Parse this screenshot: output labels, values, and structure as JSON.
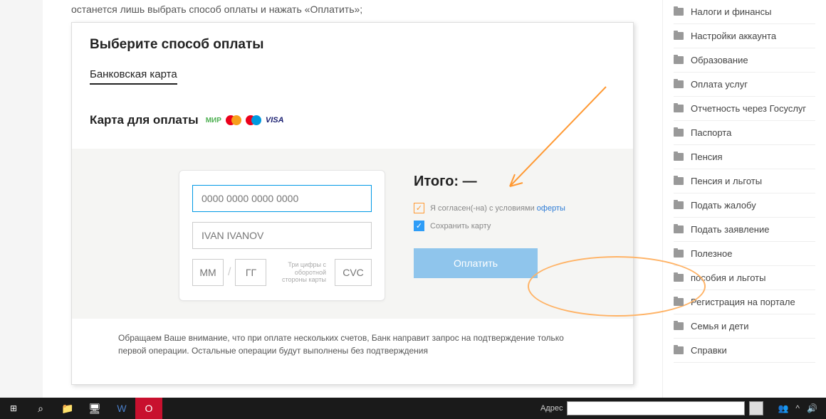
{
  "intro": "останется лишь выбрать способ оплаты и нажать «Оплатить»;",
  "panel": {
    "title": "Выберите способ оплаты",
    "tab": "Банковская карта",
    "card_label": "Карта для оплаты",
    "logos": {
      "mir": "МИР",
      "visa": "VISA"
    },
    "card": {
      "number_ph": "0000 0000 0000 0000",
      "name_ph": "IVAN IVANOV",
      "mm_ph": "ММ",
      "yy_ph": "ГГ",
      "slash": "/",
      "hint": "Три цифры с оборотной стороны карты",
      "cvc_ph": "CVC"
    },
    "total": "Итого: —",
    "agree_text": "Я согласен(-на) с условиями ",
    "agree_link": "оферты",
    "save_text": "Сохранить карту",
    "pay": "Оплатить",
    "note": "Обращаем Ваше внимание, что при оплате нескольких счетов, Банк направит запрос на подтверждение только первой операции. Остальные операции будут выполнены без подтверждения"
  },
  "sidebar": [
    "Налоги и финансы",
    "Настройки аккаунта",
    "Образование",
    "Оплата услуг",
    "Отчетность через Госуслуг",
    "Паспорта",
    "Пенсия",
    "Пенсия и льготы",
    "Подать жалобу",
    "Подать заявление",
    "Полезное",
    "пособия и льготы",
    "Регистрация на портале",
    "Семья и дети",
    "Справки"
  ],
  "taskbar": {
    "addr": "Адрес"
  }
}
